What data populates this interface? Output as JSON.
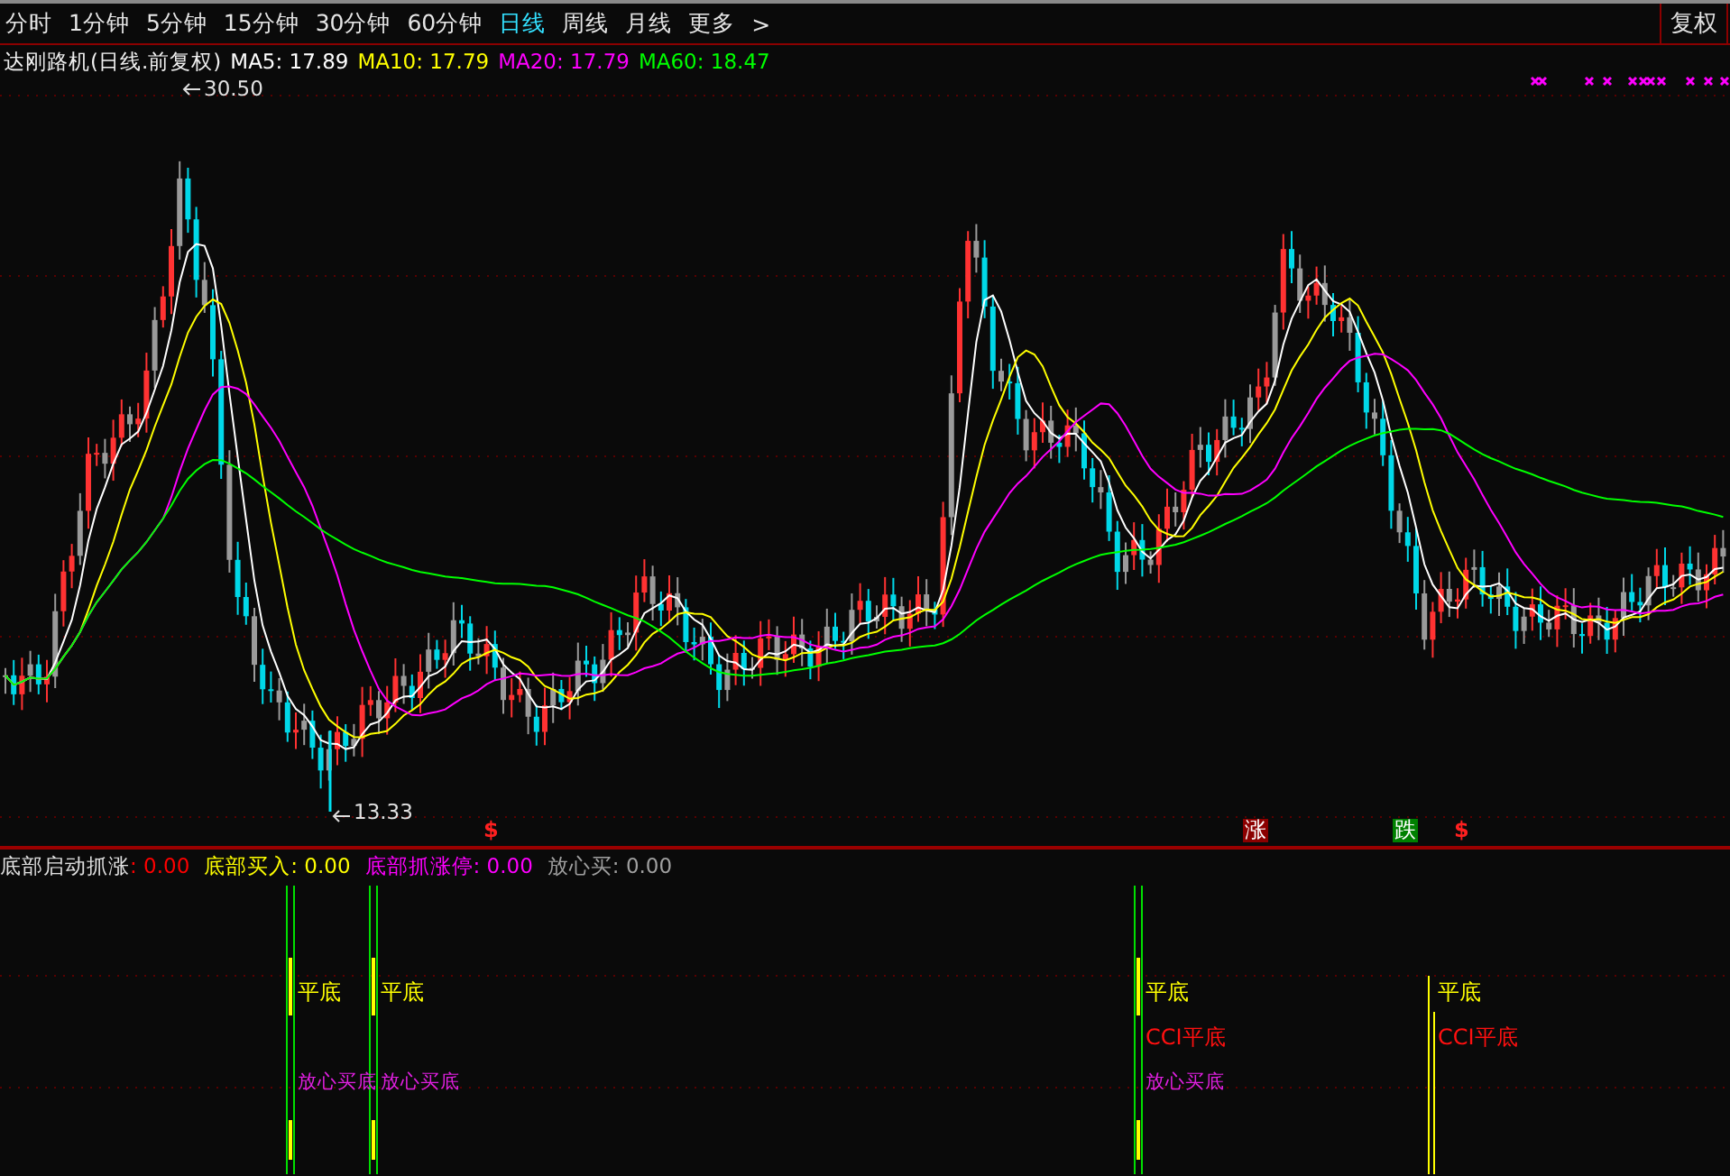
{
  "toolbar": {
    "periods": [
      {
        "label": "分时",
        "selected": false
      },
      {
        "label": "1分钟",
        "selected": false
      },
      {
        "label": "5分钟",
        "selected": false
      },
      {
        "label": "15分钟",
        "selected": false
      },
      {
        "label": "30分钟",
        "selected": false
      },
      {
        "label": "60分钟",
        "selected": false
      },
      {
        "label": "日线",
        "selected": true
      },
      {
        "label": "周线",
        "selected": false
      },
      {
        "label": "月线",
        "selected": false
      }
    ],
    "more": "更多",
    "more_arrow": ">",
    "adjust_button": "复权"
  },
  "main_chart": {
    "title": "达刚路机(日线.前复权)",
    "moving_averages": [
      {
        "label": "MA5: 17.89",
        "color": "#ffffff"
      },
      {
        "label": "MA10: 17.79",
        "color": "#ffff00"
      },
      {
        "label": "MA20: 17.79",
        "color": "#ff00ff"
      },
      {
        "label": "MA60: 18.47",
        "color": "#00ff00"
      }
    ],
    "high_label": "30.50",
    "low_label": "13.33",
    "markers": [
      {
        "kind": "dollar",
        "text": "$"
      },
      {
        "kind": "rise",
        "text": "涨",
        "color": "#8b0000"
      },
      {
        "kind": "fall",
        "text": "跌",
        "color": "#008000"
      },
      {
        "kind": "dollar",
        "text": "$"
      }
    ]
  },
  "indicator": {
    "legend": [
      {
        "kind": "split",
        "label": "底部启动抓涨",
        "value": ": 0.00",
        "color": "#ff0000"
      },
      {
        "kind": "plain",
        "label": "底部买入",
        "value": ": 0.00",
        "color": "#ffff00"
      },
      {
        "kind": "plain",
        "label": "底部抓涨停",
        "value": ": 0.00",
        "color": "#ff00ff"
      },
      {
        "kind": "plain",
        "label": "放心买",
        "value": ": 0.00",
        "color": "#a0a0a0"
      }
    ],
    "signals": [
      {
        "kind": "green",
        "labels": [
          {
            "kind": "flat",
            "text": "平底"
          },
          {
            "kind": "buy",
            "text": "放心买底"
          }
        ]
      },
      {
        "kind": "green",
        "labels": [
          {
            "kind": "flat",
            "text": "平底"
          },
          {
            "kind": "buy",
            "text": "放心买底"
          }
        ]
      },
      {
        "kind": "green",
        "labels": [
          {
            "kind": "flat",
            "text": "平底"
          },
          {
            "kind": "cci",
            "text": "CCI平底"
          },
          {
            "kind": "buy",
            "text": "放心买底"
          }
        ]
      },
      {
        "kind": "yellow",
        "labels": [
          {
            "kind": "flat",
            "text": "平底"
          },
          {
            "kind": "cci",
            "text": "CCI平底"
          }
        ]
      }
    ]
  }
}
